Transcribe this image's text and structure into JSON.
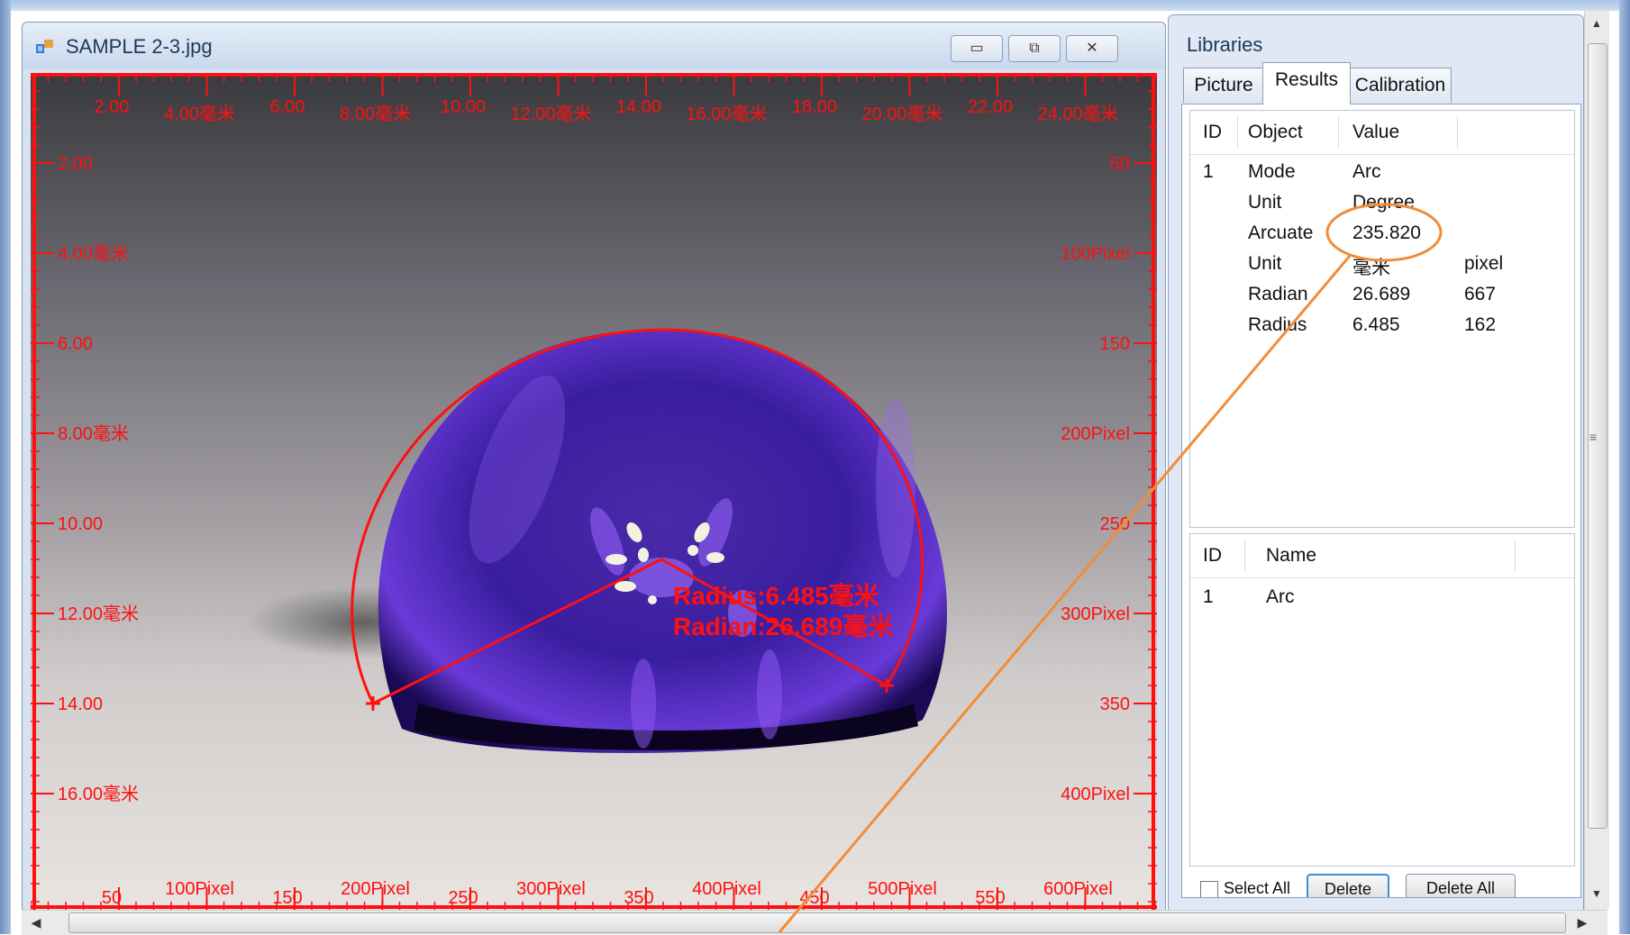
{
  "window": {
    "title": "SAMPLE 2-3.jpg",
    "minimize_label": "▭",
    "restore_label": "⧉",
    "close_label": "✕"
  },
  "image": {
    "ruler_top_labels": [
      "2.00",
      "4.00毫米",
      "6.00",
      "8.00毫米",
      "10.00",
      "12.00毫米",
      "14.00",
      "16.00毫米",
      "18.00",
      "20.00毫米",
      "22.00",
      "24.00毫米"
    ],
    "ruler_left_labels": [
      "2.00",
      "4.00毫米",
      "6.00",
      "8.00毫米",
      "10.00",
      "12.00毫米",
      "14.00",
      "16.00毫米"
    ],
    "ruler_right_labels": [
      "50",
      "100Pixel",
      "150",
      "200Pixel",
      "250",
      "300Pixel",
      "350",
      "400Pixel"
    ],
    "ruler_bottom_labels": [
      "50",
      "100Pixel",
      "150",
      "200Pixel",
      "250",
      "300Pixel",
      "350",
      "400Pixel",
      "450",
      "500Pixel",
      "550",
      "600Pixel"
    ],
    "measure_radius": "Radius:6.485毫米",
    "measure_radian": "Radian:26.689毫米",
    "ruler_color": "#ff1010"
  },
  "libraries": {
    "title": "Libraries",
    "tabs": [
      "Picture",
      "Results",
      "Calibration"
    ],
    "active_tab": "Results",
    "results_columns": [
      "ID",
      "Object",
      "Value"
    ],
    "results_rows": [
      {
        "id": "1",
        "object": "Mode",
        "value": "Arc",
        "extra": ""
      },
      {
        "id": "",
        "object": "Unit",
        "value": "Degree",
        "extra": ""
      },
      {
        "id": "",
        "object": "Arcuate",
        "value": "235.820",
        "extra": ""
      },
      {
        "id": "",
        "object": "Unit",
        "value": "毫米",
        "extra": "pixel"
      },
      {
        "id": "",
        "object": "Radian",
        "value": "26.689",
        "extra": "667"
      },
      {
        "id": "",
        "object": "Radius",
        "value": "6.485",
        "extra": "162"
      }
    ],
    "objects_columns": [
      "ID",
      "Name"
    ],
    "objects_rows": [
      {
        "id": "1",
        "name": "Arc"
      }
    ],
    "select_all_label": "Select All",
    "delete_label": "Delete",
    "delete_all_label": "Delete All"
  },
  "annotation_color": "#f28c38"
}
